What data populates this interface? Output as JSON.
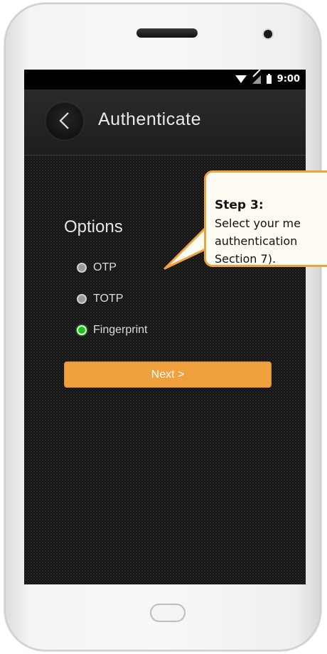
{
  "status_bar": {
    "time": "9:00"
  },
  "app_bar": {
    "title": "Authenticate"
  },
  "options": {
    "heading": "Options",
    "items": [
      {
        "label": "OTP",
        "selected": false
      },
      {
        "label": "TOTP",
        "selected": false
      },
      {
        "label": "Fingerprint",
        "selected": true
      }
    ]
  },
  "next_button": {
    "label": "Next >"
  },
  "callout": {
    "title": "Step 3:",
    "lines": [
      "Select your me",
      "authentication",
      "Section 7)."
    ]
  },
  "colors": {
    "accent": "#f0a03c",
    "selected_radio": "#1fc21a",
    "screen_bg": "#151515",
    "callout_bg": "#fefbf3"
  },
  "icons": [
    "back-chevron-icon",
    "wifi-icon",
    "signal-icon",
    "battery-icon"
  ]
}
